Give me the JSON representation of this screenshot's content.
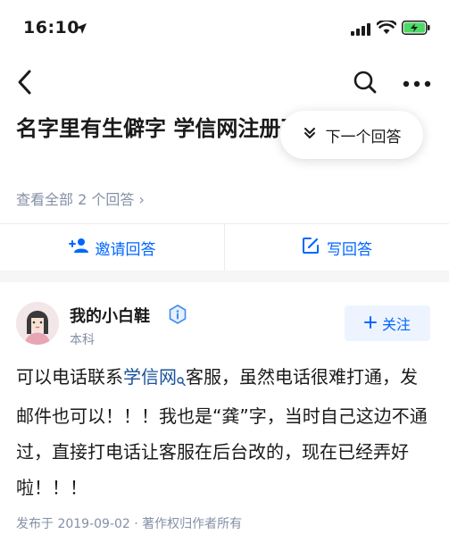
{
  "status_bar": {
    "time": "16:10"
  },
  "question": {
    "title": "名字里有生僻字 学信网注册不了怎么办?",
    "view_all": "查看全部 2 个回答 ›"
  },
  "floating": {
    "next_answer_label": "下一个回答"
  },
  "actions": {
    "invite_label": "邀请回答",
    "write_label": "写回答"
  },
  "answer": {
    "author_name": "我的小白鞋",
    "author_meta": "本科",
    "follow_label": "关注",
    "body_prefix": "可以电话联系",
    "link_text": "学信网",
    "body_suffix": "客服，虽然电话很难打通，发邮件也可以！！！我也是“龚”字，当时自己这边不通过，直接打电话让客服在后台改的，现在已经弄好啦！！！",
    "footer": "发布于 2019-09-02 · 著作权归作者所有"
  },
  "colors": {
    "accent": "#0066ff",
    "link": "#175199",
    "muted": "#8590a6",
    "battery": "#4cd964"
  },
  "icons": [
    "location-arrow-icon",
    "signal-icon",
    "wifi-icon",
    "battery-icon",
    "back-icon",
    "search-icon",
    "more-icon",
    "double-chevron-down-icon",
    "invite-user-icon",
    "edit-icon",
    "verified-icon",
    "plus-icon",
    "link-search-icon"
  ]
}
